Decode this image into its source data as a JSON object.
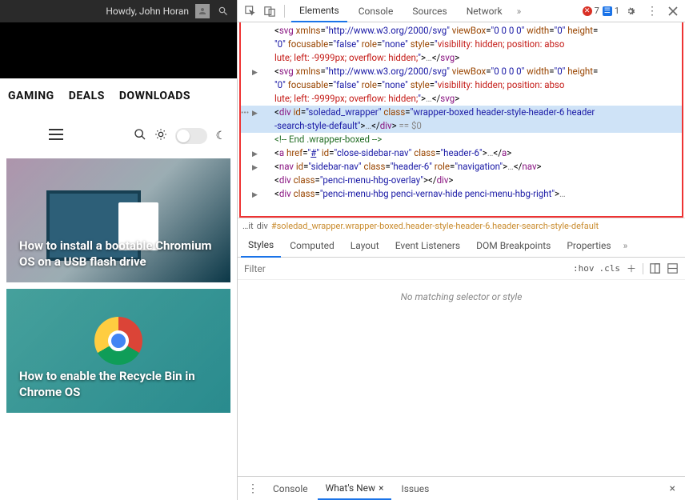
{
  "topbar": {
    "greeting": "Howdy, John Horan"
  },
  "nav": {
    "gaming": "GAMING",
    "deals": "DEALS",
    "downloads": "DOWNLOADS"
  },
  "cards": [
    {
      "title": "How to install a bootable Chromium OS on a USB flash drive"
    },
    {
      "title": "How to enable the Recycle Bin in Chrome OS"
    }
  ],
  "devtools": {
    "tabs": {
      "elements": "Elements",
      "console": "Console",
      "sources": "Sources",
      "network": "Network"
    },
    "errors": {
      "red": "7",
      "blue": "1"
    },
    "dom": {
      "l1": "<svg xmlns=\"http://www.w3.org/2000/svg\" viewBox=\"0 0 0 0\" width=\"0\" height=",
      "l2": "\"0\" focusable=\"false\" role=\"none\" style=\"visibility: hidden; position: abso",
      "l3": "lute; left: -9999px; overflow: hidden;\">…</svg>",
      "l4": "<svg xmlns=\"http://www.w3.org/2000/svg\" viewBox=\"0 0 0 0\" width=\"0\" height=",
      "l5": "\"0\" focusable=\"false\" role=\"none\" style=\"visibility: hidden; position: abso",
      "l6": "lute; left: -9999px; overflow: hidden;\">…</svg>",
      "sel1": "<div id=\"soledad_wrapper\" class=\"wrapper-boxed header-style-header-6 header",
      "sel2": "-search-style-default\">…</div> == $0",
      "comment": "<!-- End .wrapper-boxed -->",
      "a": "<a href=\"#\" id=\"close-sidebar-nav\" class=\"header-6\">…</a>",
      "nav": "<nav id=\"sidebar-nav\" class=\"header-6\" role=\"navigation\">…</nav>",
      "d1": "<div class=\"penci-menu-hbg-overlay\"></div>",
      "d2": "<div class=\"penci-menu-hbg penci-vernav-hide penci-menu-hbg-right\">…"
    },
    "breadcrumb": {
      "prefix": "…it",
      "div": "div",
      "id": "#soledad_wrapper",
      "cls": ".wrapper-boxed.header-style-header-6.header-search-style-default"
    },
    "styleTabs": {
      "styles": "Styles",
      "computed": "Computed",
      "layout": "Layout",
      "listeners": "Event Listeners",
      "dom": "DOM Breakpoints",
      "props": "Properties"
    },
    "filter": {
      "placeholder": "Filter",
      "hov": ":hov",
      "cls": ".cls"
    },
    "stylesBody": "No matching selector or style",
    "drawer": {
      "console": "Console",
      "whatsnew": "What's New",
      "issues": "Issues"
    }
  }
}
